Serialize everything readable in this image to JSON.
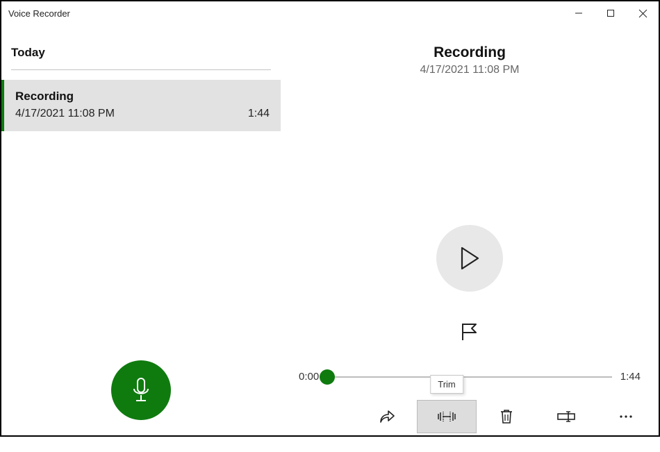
{
  "app": {
    "title": "Voice Recorder"
  },
  "sidebar": {
    "section": "Today",
    "item": {
      "name": "Recording",
      "date": "4/17/2021 11:08 PM",
      "duration": "1:44"
    }
  },
  "main": {
    "title": "Recording",
    "date": "4/17/2021 11:08 PM",
    "currentTime": "0:00",
    "totalTime": "1:44"
  },
  "tooltip": {
    "trim": "Trim"
  },
  "colors": {
    "accent": "#0f7b0f",
    "highlight": "#d60000"
  }
}
